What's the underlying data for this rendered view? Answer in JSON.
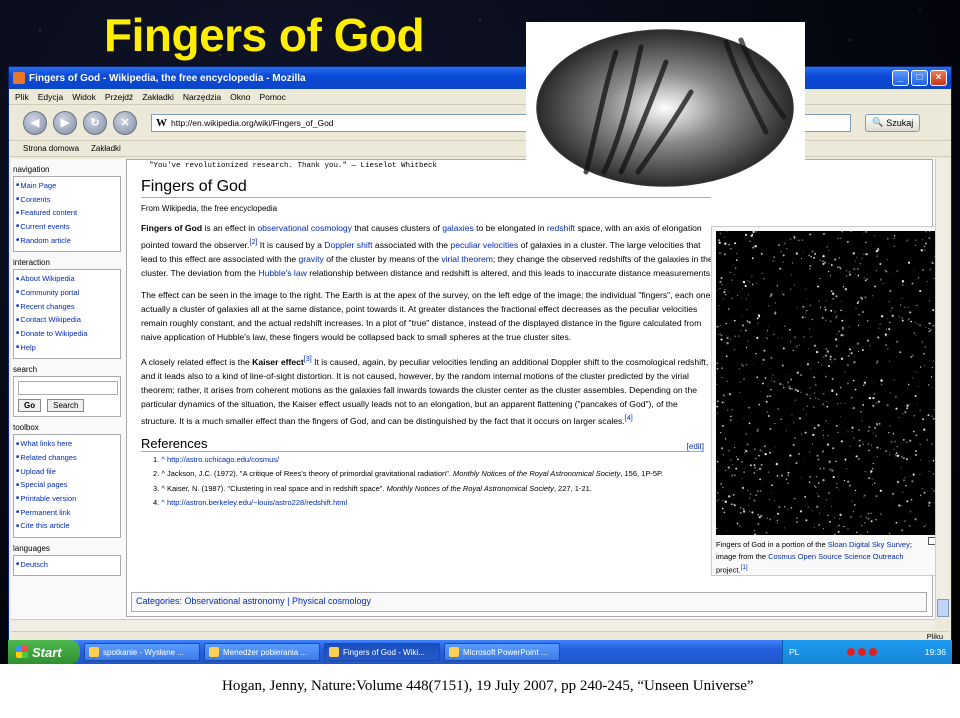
{
  "slide": {
    "title": "Fingers of God",
    "caption": "Hogan, Jenny, Nature:Volume 448(7151), 19 July 2007, pp 240-245, “Unseen Universe”"
  },
  "window": {
    "title": "Fingers of God - Wikipedia, the free encyclopedia - Mozilla",
    "menu": [
      "Plik",
      "Edycja",
      "Widok",
      "Przejdź",
      "Zakładki",
      "Narzędzia",
      "Okno",
      "Pomoc"
    ],
    "url": "http://en.wikipedia.org/wiki/Fingers_of_God",
    "search_label": "Szukaj",
    "bookmarks": [
      "Strona domowa",
      "Zakładki"
    ],
    "controls": {
      "minimize": "_",
      "maximize": "□",
      "close": "×"
    }
  },
  "sidebar": {
    "navigation_heading": "navigation",
    "navigation": [
      "Main Page",
      "Contents",
      "Featured content",
      "Current events",
      "Random article"
    ],
    "interaction_heading": "interaction",
    "interaction": [
      "About Wikipedia",
      "Community portal",
      "Recent changes",
      "Contact Wikipedia",
      "Donate to Wikipedia",
      "Help"
    ],
    "search_heading": "search",
    "go_label": "Go",
    "search_label": "Search",
    "toolbox_heading": "toolbox",
    "toolbox": [
      "What links here",
      "Related changes",
      "Upload file",
      "Special pages",
      "Printable version",
      "Permanent link",
      "Cite this article"
    ],
    "languages_heading": "languages",
    "languages": [
      "Deutsch"
    ]
  },
  "article": {
    "quote": "\"You've revolutionized research. Thank you.\" — Lieselot Whitbeck",
    "title": "Fingers of God",
    "from": "From Wikipedia, the free encyclopedia",
    "p1": {
      "bold": "Fingers of God",
      "t1": " is an effect in ",
      "l1": "observational cosmology",
      "t2": " that causes clusters of ",
      "l2": "galaxies",
      "t3": " to be elongated in ",
      "l3": "redshift",
      "t4": " space, with an axis of elongation pointed toward the observer.",
      "s1": "[2]",
      "t5": " It is caused by a ",
      "l4": "Doppler shift",
      "t6": " associated with the ",
      "l5": "peculiar velocities",
      "t7": " of galaxies in a cluster. The large velocities that lead to this effect are associated with the ",
      "l6": "gravity",
      "t8": " of the cluster by means of the ",
      "l7": "virial theorem",
      "t9": "; they change the observed redshifts of the galaxies in the cluster. The deviation from the ",
      "l8": "Hubble's law",
      "t10": " relationship between distance and redshift is altered, and this leads to inaccurate distance measurements."
    },
    "p2": "The effect can be seen in the image to the right. The Earth is at the apex of the survey, on the left edge of the image; the individual \"fingers\", each one actually a cluster of galaxies all at the same distance, point towards it. At greater distances the fractional effect decreases as the peculiar velocities remain roughly constant, and the actual redshift increases. In a plot of \"true\" distance, instead of the displayed distance in the figure calculated from naive application of Hubble's law, these fingers would be collapsed back to small spheres at the true cluster sites.",
    "p3": {
      "t1": "A closely related effect is the ",
      "bold": "Kaiser effect",
      "s1": "[3]",
      "t2": " It is caused, again, by peculiar velocities lending an additional Doppler shift to the cosmological redshift, and it leads also to a kind of line-of-sight distortion. It is not caused, however, by the random internal motions of the cluster predicted by the virial theorem; rather, it arises from coherent motions as the galaxies fall inwards towards the cluster center as the cluster assembles. Depending on the particular dynamics of the situation, the Kaiser effect usually leads not to an elongation, but an apparent flattening (\"pancakes of God\"), of the structure. It is a much smaller effect than the fingers of God, and can be distinguished by the fact that it occurs on larger scales.",
      "s2": "[4]"
    },
    "references_heading": "References",
    "edit_label": "[edit]",
    "references": [
      {
        "n": "1.",
        "text": "^ http://astro.uchicago.edu/cosmus/",
        "ital": "",
        "tail": ""
      },
      {
        "n": "2.",
        "text": "^ Jackson, J.C. (1972). \"A critique of Rees's theory of primordial gravitational radiation\". ",
        "ital": "Monthly Notices of the Royal Astronomical Society",
        "tail": ", 156, 1P-5P."
      },
      {
        "n": "3.",
        "text": "^ Kaiser, N. (1987). \"Clustering in real space and in redshift space\". ",
        "ital": "Monthly Notices of the Royal Astronomical Society",
        "tail": ", 227, 1-21."
      },
      {
        "n": "4.",
        "text": "^ http://astron.berkeley.edu/~louis/astro228/redshift.html",
        "ital": "",
        "tail": ""
      }
    ],
    "categories_label": "Categories:",
    "categories": [
      "Observational astronomy",
      "Physical cosmology"
    ],
    "figure_caption": {
      "t1": "Fingers of God in a portion of the ",
      "l1": "Sloan Digital Sky Survey",
      "t2": "; image from the ",
      "l2": "Cosmus Open Source Science Outreach",
      "t3": " project.",
      "s1": "[1]"
    }
  },
  "statusbar": {
    "right": "Pliku"
  },
  "taskbar": {
    "start_label": "Start",
    "tasks": [
      "spotkanie - Wysłane ...",
      "Menedżer pobierania ...",
      "Fingers of God - Wiki...",
      "Microsoft PowerPoint ..."
    ],
    "lang": "PL",
    "clock": "19:36"
  },
  "colors": {
    "link": "#002bb8",
    "title_yellow": "#ffee00",
    "taskbar_blue": "#245edb",
    "start_green": "#2f8f2f"
  }
}
